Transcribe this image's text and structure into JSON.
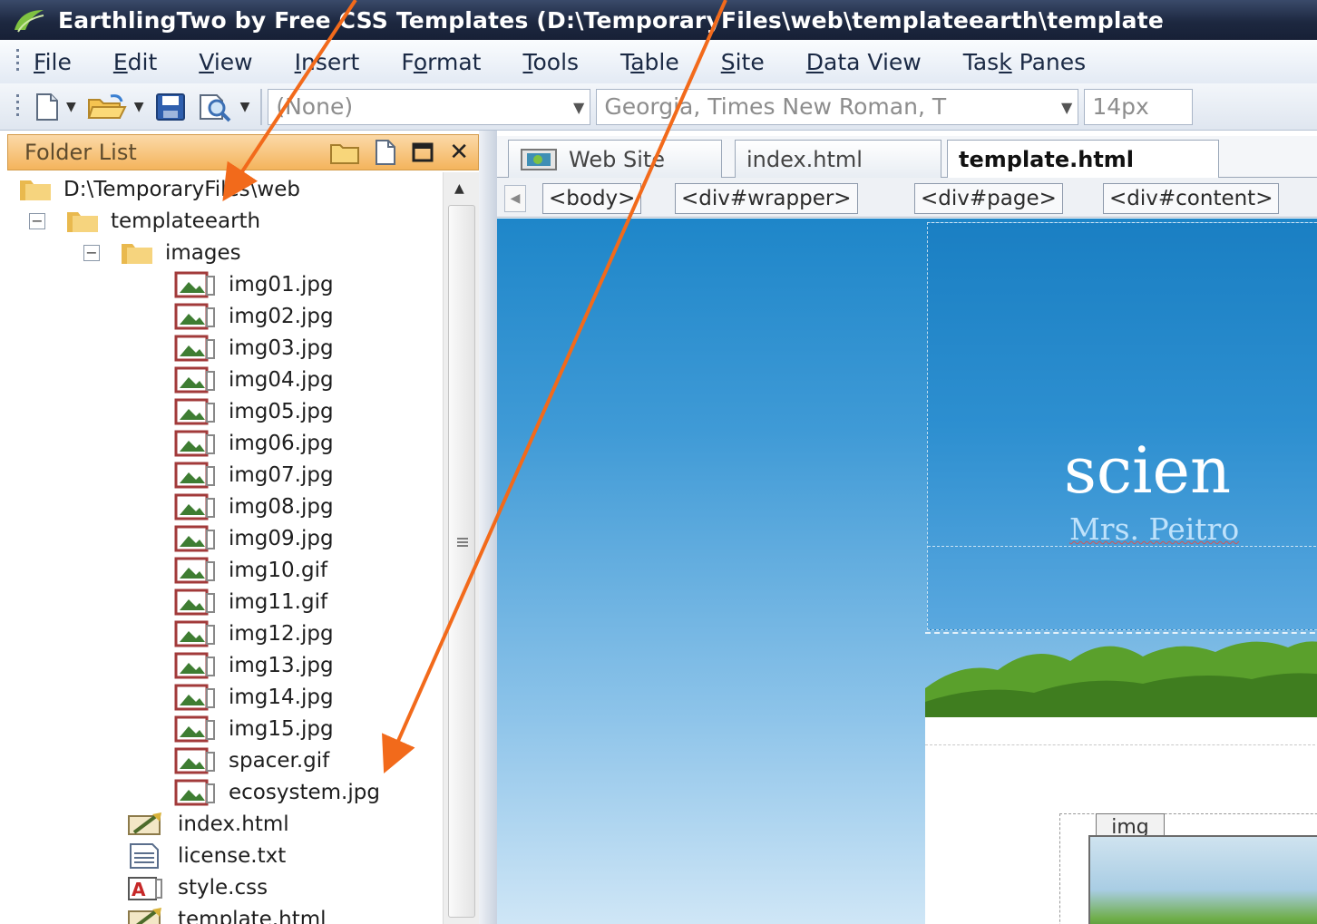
{
  "window": {
    "title": "EarthlingTwo by Free CSS Templates (D:\\TemporaryFiles\\web\\templateearth\\template"
  },
  "menu": {
    "items": [
      {
        "pre": "",
        "acc": "F",
        "post": "ile"
      },
      {
        "pre": "",
        "acc": "E",
        "post": "dit"
      },
      {
        "pre": "",
        "acc": "V",
        "post": "iew"
      },
      {
        "pre": "",
        "acc": "I",
        "post": "nsert"
      },
      {
        "pre": "F",
        "acc": "o",
        "post": "rmat"
      },
      {
        "pre": "",
        "acc": "T",
        "post": "ools"
      },
      {
        "pre": "T",
        "acc": "a",
        "post": "ble"
      },
      {
        "pre": "",
        "acc": "S",
        "post": "ite"
      },
      {
        "pre": "",
        "acc": "D",
        "post": "ata View"
      },
      {
        "pre": "Tas",
        "acc": "k",
        "post": " Panes"
      }
    ]
  },
  "toolbar": {
    "style_value": "(None)",
    "font_value": "Georgia, Times New Roman, T",
    "size_value": "14px"
  },
  "folder_list": {
    "title": "Folder List",
    "root": "D:\\TemporaryFiles\\web",
    "folder": "templateearth",
    "subfolder": "images",
    "image_files": [
      "img01.jpg",
      "img02.jpg",
      "img03.jpg",
      "img04.jpg",
      "img05.jpg",
      "img06.jpg",
      "img07.jpg",
      "img08.jpg",
      "img09.jpg",
      "img10.gif",
      "img11.gif",
      "img12.jpg",
      "img13.jpg",
      "img14.jpg",
      "img15.jpg",
      "spacer.gif",
      "ecosystem.jpg"
    ],
    "files": [
      {
        "name": "index.html",
        "icon": "html-page-icon"
      },
      {
        "name": "license.txt",
        "icon": "text-file-icon"
      },
      {
        "name": "style.css",
        "icon": "css-file-icon"
      },
      {
        "name": "template.html",
        "icon": "html-page-icon"
      }
    ]
  },
  "editor": {
    "tabs": [
      {
        "label": "Web Site",
        "active": false
      },
      {
        "label": "index.html",
        "active": false
      },
      {
        "label": "template.html",
        "active": true
      }
    ],
    "tags": [
      "<body>",
      "<div#wrapper>",
      "<div#page>",
      "<div#content>"
    ],
    "page_title": "scien",
    "page_subtitle": "Mrs. Peitro",
    "img_tag_label": "img"
  },
  "colors": {
    "header_bg": "#1d2840",
    "panel_header": "#f4b45c",
    "arrow": "#f26a1b",
    "sky": "#1e86c9"
  }
}
